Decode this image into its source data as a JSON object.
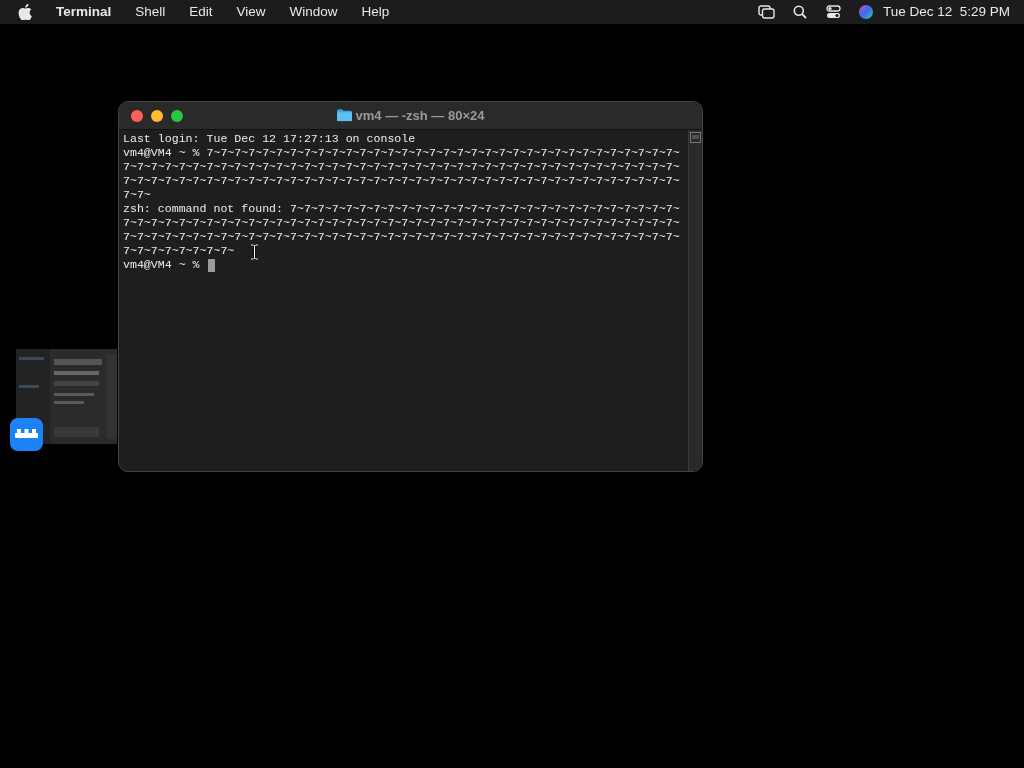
{
  "menu_bar": {
    "app_name": "Terminal",
    "menus": [
      "Shell",
      "Edit",
      "View",
      "Window",
      "Help"
    ],
    "clock": "Tue Dec 12  5:29 PM"
  },
  "terminal_window": {
    "title": "vm4 — -zsh — 80×24",
    "lines": [
      "Last login: Tue Dec 12 17:27:13 on console",
      "vm4@VM4 ~ % 7~7~7~7~7~7~7~7~7~7~7~7~7~7~7~7~7~7~7~7~7~7~7~7~7~7~7~7~7~7~7~7~7~7~",
      "7~7~7~7~7~7~7~7~7~7~7~7~7~7~7~7~7~7~7~7~7~7~7~7~7~7~7~7~7~7~7~7~7~7~7~7~7~7~7~7~",
      "7~7~7~7~7~7~7~7~7~7~7~7~7~7~7~7~7~7~7~7~7~7~7~7~7~7~7~7~7~7~7~7~7~7~7~7~7~7~7~7~",
      "7~7~",
      "zsh: command not found: 7~7~7~7~7~7~7~7~7~7~7~7~7~7~7~7~7~7~7~7~7~7~7~7~7~7~7~7~",
      "7~7~7~7~7~7~7~7~7~7~7~7~7~7~7~7~7~7~7~7~7~7~7~7~7~7~7~7~7~7~7~7~7~7~7~7~7~7~7~7~",
      "7~7~7~7~7~7~7~7~7~7~7~7~7~7~7~7~7~7~7~7~7~7~7~7~7~7~7~7~7~7~7~7~7~7~7~7~7~7~7~7~",
      "7~7~7~7~7~7~7~7~"
    ],
    "prompt": "vm4@VM4 ~ %"
  }
}
